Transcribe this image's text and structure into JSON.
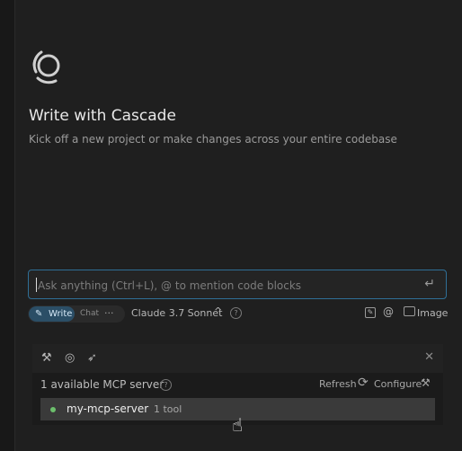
{
  "hero": {
    "title": "Write with Cascade",
    "subtitle": "Kick off a new project or make changes across your entire codebase"
  },
  "input": {
    "placeholder": "Ask anything (Ctrl+L), @ to mention code blocks",
    "enter_icon": "↵"
  },
  "toolbar": {
    "mode_write": "Write",
    "mode_chat": "Chat",
    "more": "···",
    "model": "Claude 3.7 Sonnet",
    "model_chevron": "^",
    "help": "?",
    "at": "@",
    "image_label": "Image"
  },
  "mcp": {
    "count_label": "1 available MCP server",
    "help": "?",
    "refresh_label": "Refresh",
    "configure_label": "Configure",
    "close": "✕",
    "servers": [
      {
        "name": "my-mcp-server",
        "tools": "1 tool",
        "status_color": "#6cbf6c"
      }
    ]
  },
  "colors": {
    "background": "#1f1f1f",
    "accent": "#2f6f97",
    "write_pill": "#2b4e66"
  }
}
